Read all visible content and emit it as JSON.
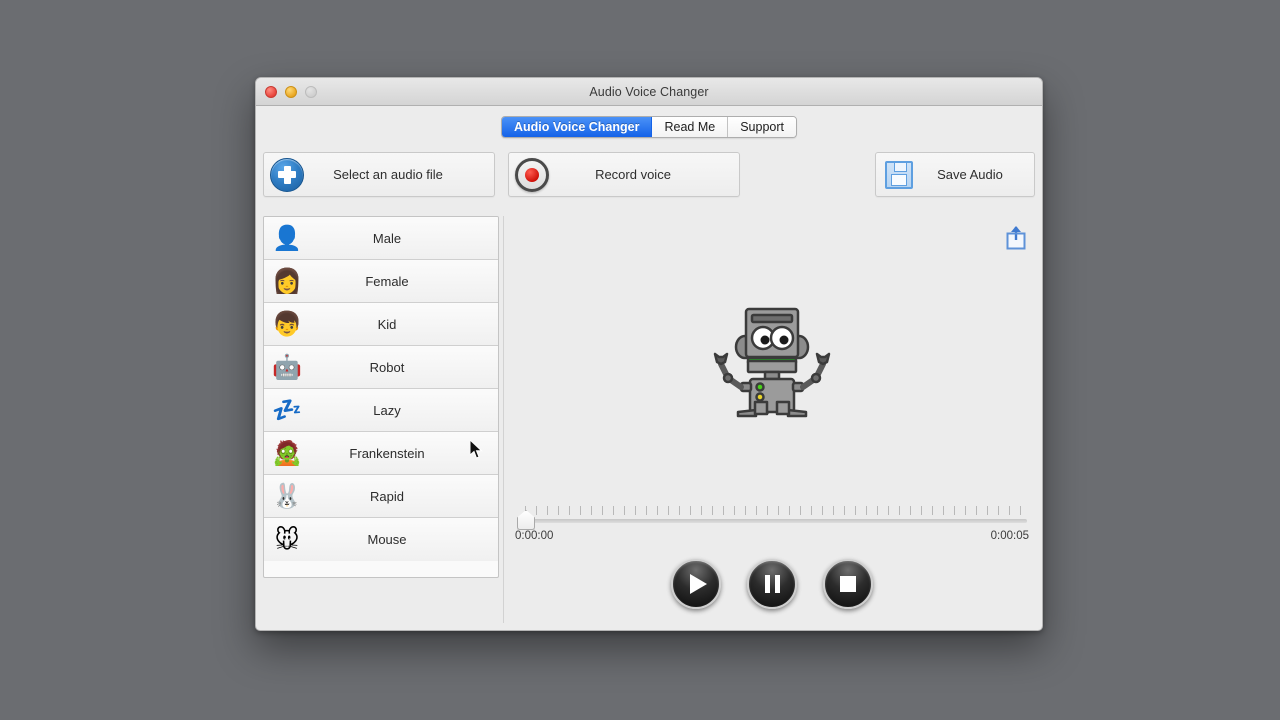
{
  "window": {
    "title": "Audio Voice Changer",
    "controls": {
      "close": "close",
      "minimize": "minimize",
      "maximize": "maximize"
    }
  },
  "tabs": [
    {
      "label": "Audio Voice Changer",
      "active": true
    },
    {
      "label": "Read Me",
      "active": false
    },
    {
      "label": "Support",
      "active": false
    }
  ],
  "toolbar": {
    "select_label": "Select an audio file",
    "select_icon": "plus-circle-icon",
    "record_label": "Record voice",
    "record_icon": "record-dot-icon",
    "save_label": "Save Audio",
    "save_icon": "floppy-disk-icon"
  },
  "voices": [
    {
      "label": "Male",
      "icon": "👤",
      "icon_name": "man-avatar-icon"
    },
    {
      "label": "Female",
      "icon": "👩",
      "icon_name": "woman-avatar-icon"
    },
    {
      "label": "Kid",
      "icon": "👦",
      "icon_name": "boy-avatar-icon"
    },
    {
      "label": "Robot",
      "icon": "🤖",
      "icon_name": "robot-avatar-icon"
    },
    {
      "label": "Lazy",
      "icon": "💤",
      "icon_name": "zzz-sleep-icon"
    },
    {
      "label": "Frankenstein",
      "icon": "🧟",
      "icon_name": "frankenstein-head-icon"
    },
    {
      "label": "Rapid",
      "icon": "🐰",
      "icon_name": "rabbit-face-icon"
    },
    {
      "label": "Mouse",
      "icon": "🐭",
      "icon_name": "mouse-face-icon"
    }
  ],
  "main": {
    "share_icon": "share-export-icon",
    "preview_icon": "robot-illustration"
  },
  "timeline": {
    "start_time": "0:00:00",
    "end_time": "0:00:05",
    "playhead_position": "0:00:00"
  },
  "transport": {
    "play_label": "play-button",
    "pause_label": "pause-button",
    "stop_label": "stop-button"
  },
  "colors": {
    "accent_blue": "#1462e8",
    "desktop": "#6b6d71",
    "window_bg": "#ececec",
    "record_red": "#cc0d05",
    "robot_green": "#20c020"
  }
}
